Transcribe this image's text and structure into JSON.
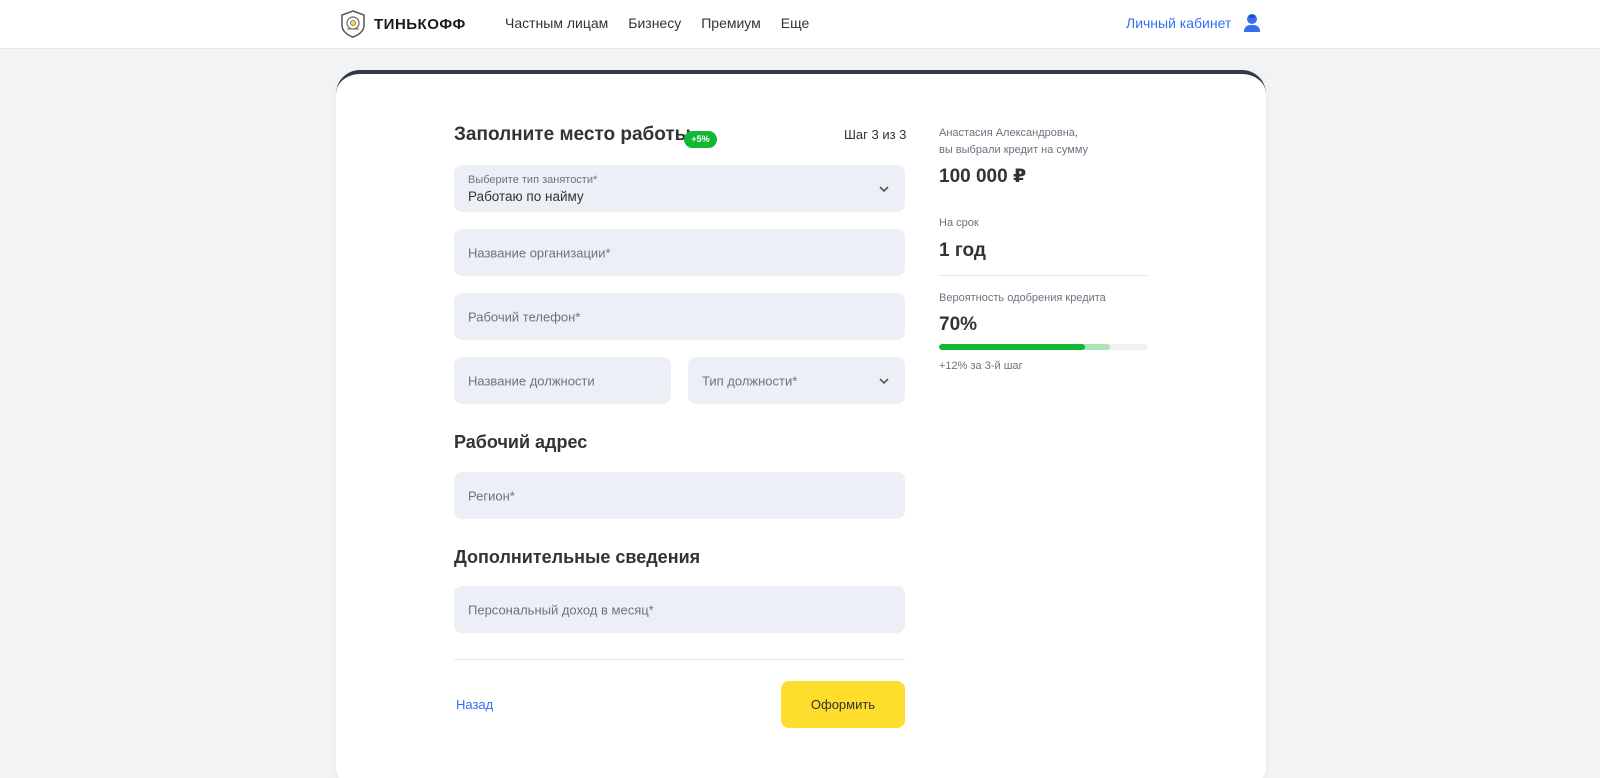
{
  "header": {
    "logo_text": "ТИНЬКОФФ",
    "nav": [
      "Частным лицам",
      "Бизнесу",
      "Премиум",
      "Еще"
    ],
    "cabinet_label": "Личный кабинет"
  },
  "form": {
    "title": "Заполните место работы",
    "badge": "+5%",
    "step": "Шаг 3 из 3",
    "employment": {
      "label": "Выберите тип занятости*",
      "value": "Работаю по найму"
    },
    "org_placeholder": "Название организации*",
    "phone_placeholder": "Рабочий телефон*",
    "position_placeholder": "Название должности",
    "position_type_placeholder": "Тип должности*",
    "address_title": "Рабочий адрес",
    "region_placeholder": "Регион*",
    "extra_title": "Дополнительные сведения",
    "income_placeholder": "Персональный доход в месяц*",
    "back_label": "Назад",
    "submit_label": "Оформить"
  },
  "sidebar": {
    "greeting_line1": "Анастасия Александровна,",
    "greeting_line2": "вы выбрали кредит на сумму",
    "amount": "100 000 ₽",
    "term_label": "На срок",
    "term": "1 год",
    "probability_label": "Вероятность одобрения кредита",
    "probability": "70%",
    "probability_value": 0.7,
    "probability_bonus_value": 0.82,
    "hint": "+12% за 3-й шаг"
  },
  "colors": {
    "accent_blue": "#336fee",
    "brand_yellow": "#ffdd2d",
    "success_green": "#12b733",
    "field_bg": "#ecf0f6"
  }
}
